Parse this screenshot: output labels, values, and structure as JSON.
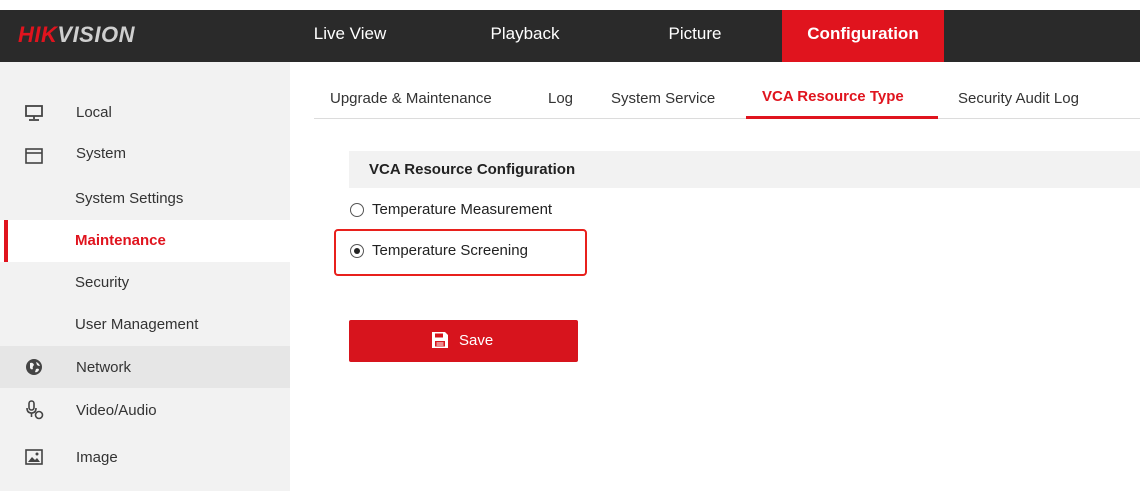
{
  "brand": {
    "logo_prefix": "HIK",
    "logo_suffix": "VISION"
  },
  "topnav": {
    "items": [
      {
        "label": "Live View"
      },
      {
        "label": "Playback"
      },
      {
        "label": "Picture"
      },
      {
        "label": "Configuration",
        "active": true
      }
    ]
  },
  "sidebar": {
    "items": [
      {
        "label": "Local",
        "icon": "monitor-icon"
      },
      {
        "label": "System",
        "icon": "window-icon"
      },
      {
        "label": "System Settings"
      },
      {
        "label": "Maintenance",
        "selected": true
      },
      {
        "label": "Security"
      },
      {
        "label": "User Management"
      },
      {
        "label": "Network",
        "icon": "globe-icon"
      },
      {
        "label": "Video/Audio",
        "icon": "microphone-camera-icon"
      },
      {
        "label": "Image",
        "icon": "image-icon"
      }
    ]
  },
  "tabs": {
    "items": [
      {
        "label": "Upgrade & Maintenance"
      },
      {
        "label": "Log"
      },
      {
        "label": "System Service"
      },
      {
        "label": "VCA Resource Type",
        "active": true
      },
      {
        "label": "Security Audit Log"
      }
    ]
  },
  "content": {
    "section_title": "VCA Resource Configuration",
    "options": [
      {
        "label": "Temperature Measurement",
        "checked": false
      },
      {
        "label": "Temperature Screening",
        "checked": true
      }
    ],
    "save_label": "Save"
  },
  "colors": {
    "accent": "#e0141e",
    "topbar": "#2a2a2a",
    "sidebar": "#f2f2f2"
  }
}
